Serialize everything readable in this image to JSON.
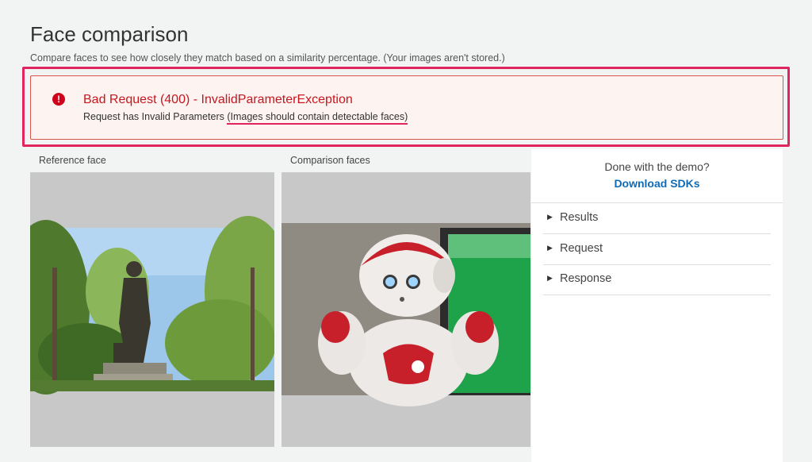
{
  "page": {
    "title": "Face comparison",
    "subtitle": "Compare faces to see how closely they match based on a similarity percentage. (Your images aren't stored.)"
  },
  "error": {
    "icon": "exclamation-circle-icon",
    "title": "Bad Request (400) - InvalidParameterException",
    "message_prefix": "Request has Invalid Parameters ",
    "message_hint": "(Images should contain detectable faces)",
    "colors": {
      "title": "#c7161e",
      "border": "#d9534f",
      "highlight": "#e0245e"
    }
  },
  "panels": {
    "reference_label": "Reference face",
    "comparison_label": "Comparison faces"
  },
  "sidebar": {
    "done_text": "Done with the demo?",
    "download_link": "Download SDKs",
    "sections": [
      {
        "label": "Results",
        "icon": "caret-right-icon"
      },
      {
        "label": "Request",
        "icon": "caret-right-icon"
      },
      {
        "label": "Response",
        "icon": "caret-right-icon"
      }
    ]
  }
}
